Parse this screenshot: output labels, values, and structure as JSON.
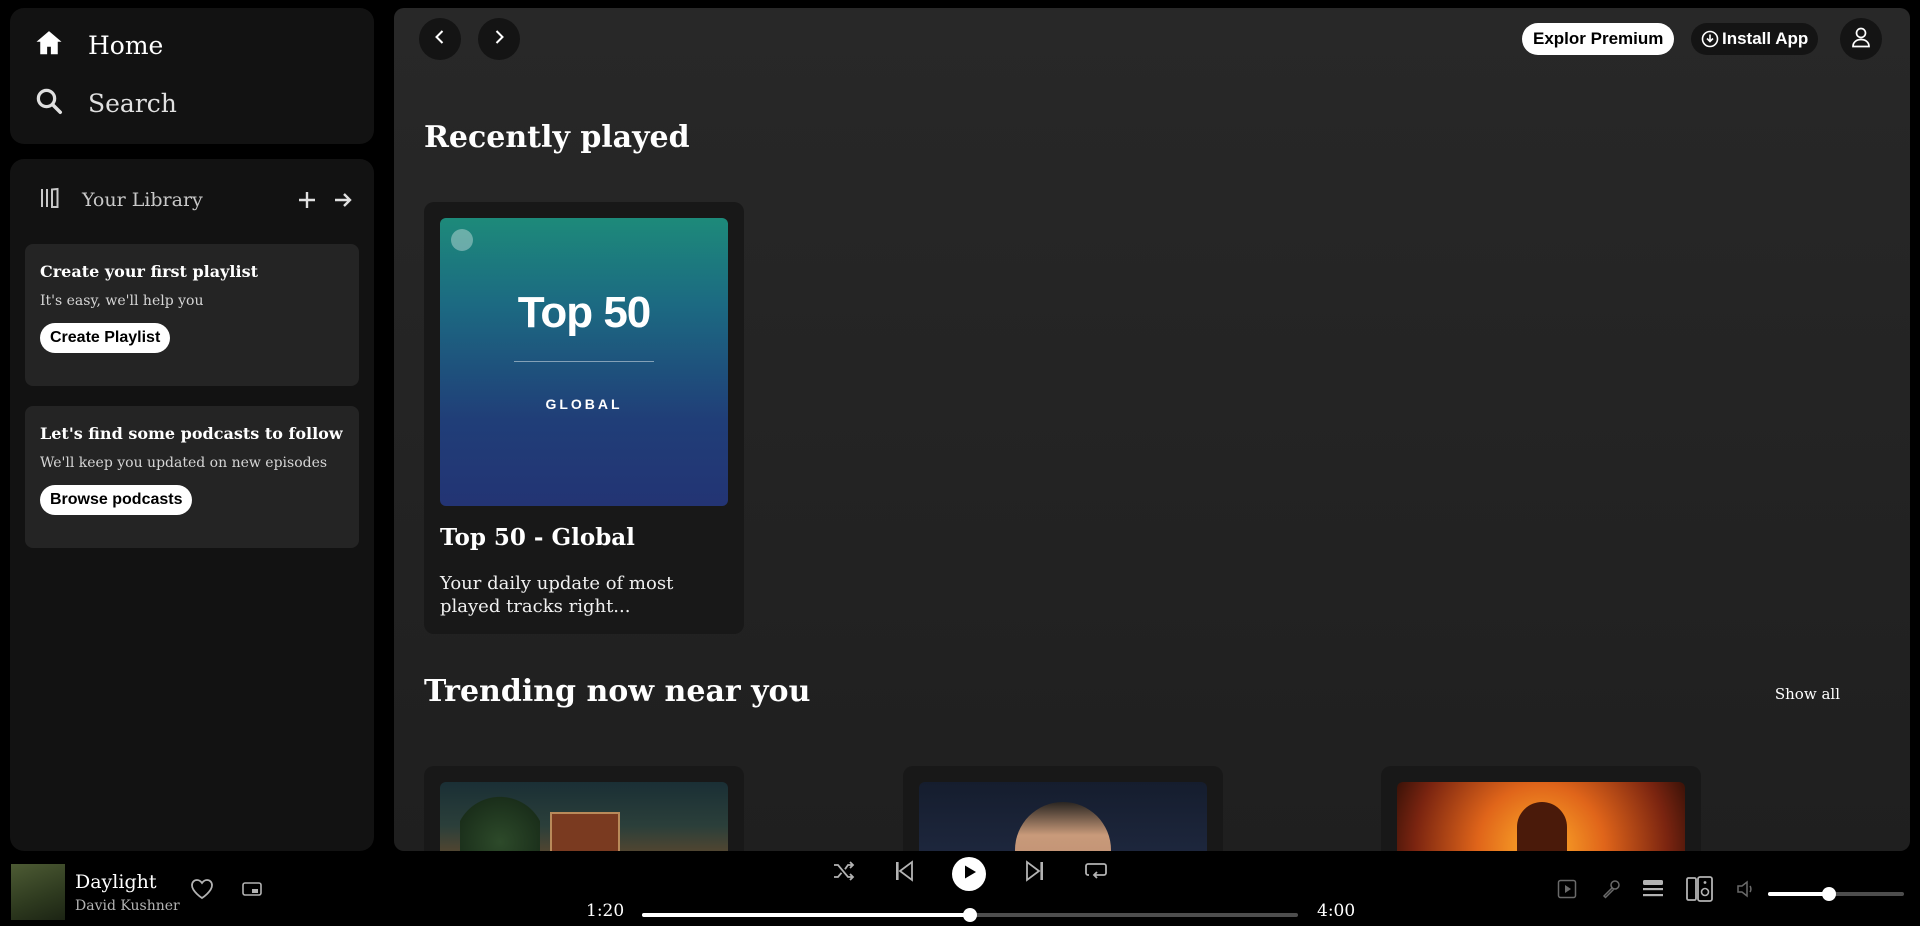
{
  "sidebar": {
    "nav": {
      "home_label": "Home",
      "search_label": "Search"
    },
    "library": {
      "label": "Your Library",
      "cards": [
        {
          "title": "Create your first playlist",
          "subtitle": "It's easy, we'll help you",
          "button": "Create Playlist"
        },
        {
          "title": "Let's find some podcasts to follow",
          "subtitle": "We'll keep you updated on new episodes",
          "button": "Browse podcasts"
        }
      ]
    }
  },
  "header": {
    "premium_label": "Explor Premium",
    "install_label": "Install App"
  },
  "main": {
    "recently_played": {
      "title": "Recently played",
      "items": [
        {
          "cover_big": "Top 50",
          "cover_small": "GLOBAL",
          "title": "Top 50 - Global",
          "description": "Your daily update of most played tracks right..."
        }
      ]
    },
    "trending": {
      "title": "Trending now near you",
      "show_all": "Show all"
    }
  },
  "player": {
    "track_title": "Daylight",
    "artist": "David Kushner",
    "elapsed": "1:20",
    "duration": "4:00",
    "progress_fraction": 0.5,
    "volume_fraction": 0.45
  },
  "colors": {
    "accent": "#ffffff",
    "background": "#000000",
    "panel": "#121212"
  }
}
